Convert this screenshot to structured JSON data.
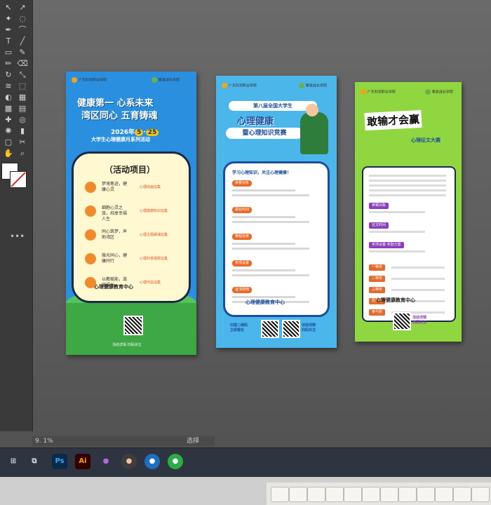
{
  "toolbar": {
    "tools": [
      "selection-tool",
      "direct-selection-tool",
      "magic-wand-tool",
      "lasso-tool",
      "pen-tool",
      "curvature-tool",
      "type-tool",
      "line-tool",
      "rectangle-tool",
      "paintbrush-tool",
      "pencil-tool",
      "eraser-tool",
      "rotate-tool",
      "scale-tool",
      "width-tool",
      "free-transform-tool",
      "shape-builder-tool",
      "perspective-tool",
      "mesh-tool",
      "gradient-tool",
      "eyedropper-tool",
      "blend-tool",
      "symbol-sprayer-tool",
      "column-graph-tool",
      "artboard-tool",
      "slice-tool",
      "hand-tool",
      "zoom-tool"
    ],
    "more": "•••"
  },
  "status": {
    "zoom": "9. 1%",
    "selection": "选择"
  },
  "taskbar": {
    "apps": [
      {
        "label": "Ps",
        "icon": "photoshop-icon",
        "color": "#0a2a4a",
        "fg": "#31a8ff"
      },
      {
        "label": "Ai",
        "icon": "illustrator-icon",
        "color": "#330000",
        "fg": "#ff9a00"
      },
      {
        "label": "",
        "icon": "app-triangle-icon",
        "color": "#2e3440",
        "fg": "#b06ae0"
      },
      {
        "label": "",
        "icon": "avatar-app-icon",
        "color": "#3d3d3d",
        "fg": "#f0c0a0"
      },
      {
        "label": "",
        "icon": "app-x-icon",
        "color": "#1e6fbf",
        "fg": "#ffffff"
      },
      {
        "label": "",
        "icon": "wechat-icon",
        "color": "#2aae43",
        "fg": "#ffffff"
      }
    ]
  },
  "poster1": {
    "logo_left": "广东科贸职业学院",
    "logo_right": "繁星成长学院",
    "title_line1": "健康第一  心系未来",
    "title_line2": "湾区同心  五育铸魂",
    "date_prefix": "2026年",
    "date_month": "5",
    "date_day": "25",
    "subtitle": "大学生心理健康月系列活动",
    "card_title": "（活动项目）",
    "rows": [
      {
        "label": "梦境笔迹，健康心灵",
        "tag": "心理绘画征集"
      },
      {
        "label": "细胞心灵之旅，纯享幸福人生",
        "tag": "心理健康知识征集"
      },
      {
        "label": "同心筑梦，声助湾区",
        "tag": "心理主题朗诵征集"
      },
      {
        "label": "微光同心，健康同行",
        "tag": "心理科普视频征集"
      },
      {
        "label": "以教赋能，滋润成长",
        "tag": "心理作品征集"
      }
    ],
    "org": "心理健康教育中心",
    "footer": "活动详情    扫码关注"
  },
  "poster2": {
    "logo_left": "广东科贸职业学院",
    "logo_right": "繁星成长学院",
    "head": "第八届全国大学生",
    "title_line1": "心理健康",
    "title_line2": "暨心理知识竞赛",
    "slogan": "学习心理知识，关注心理健康！",
    "sections": [
      "参赛对象",
      "报名时间",
      "赛程安排",
      "奖项设置",
      "证书样例"
    ],
    "org": "心理健康教育中心",
    "footer_left": "扫描二维码\n立即报名",
    "footer_right": "活动详情\n扫码关注"
  },
  "poster3": {
    "logo_left": "广东科贸职业学院",
    "logo_right": "繁星成长学院",
    "title": "敢输才会赢",
    "subtitle": "心理征文大赛",
    "sections": [
      "参赛对象",
      "征文时间",
      "奖项设置·奖励方案"
    ],
    "awards": [
      "一等奖",
      "二等奖",
      "三等奖",
      "优秀奖",
      "参与奖"
    ],
    "org": "心理健康教育中心",
    "footer": "活动详情\n扫码关注"
  }
}
